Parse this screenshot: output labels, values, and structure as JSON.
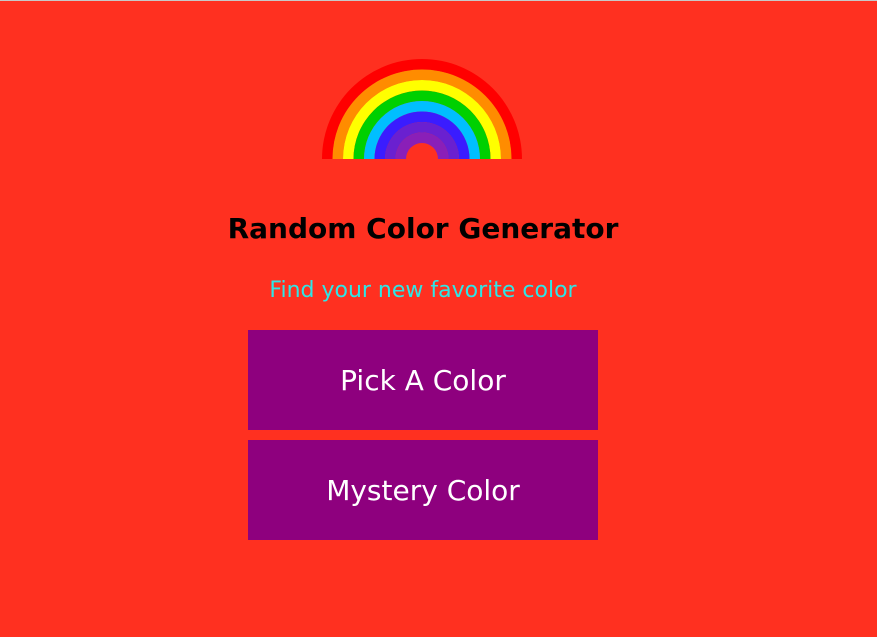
{
  "theme": {
    "background": "#ff3020",
    "button_bg": "#8e007e",
    "subtitle_color": "#2ee6e6"
  },
  "header": {
    "logo_icon": "rainbow-icon",
    "rainbow_colors": [
      "#ff0000",
      "#ff8c00",
      "#ffff00",
      "#00d000",
      "#00bfff",
      "#3a1cff",
      "#6a20d0",
      "#8a1fb8"
    ]
  },
  "main": {
    "title": "Random Color Generator",
    "subtitle": "Find your new favorite color",
    "buttons": {
      "pick": "Pick A Color",
      "mystery": "Mystery Color"
    }
  }
}
